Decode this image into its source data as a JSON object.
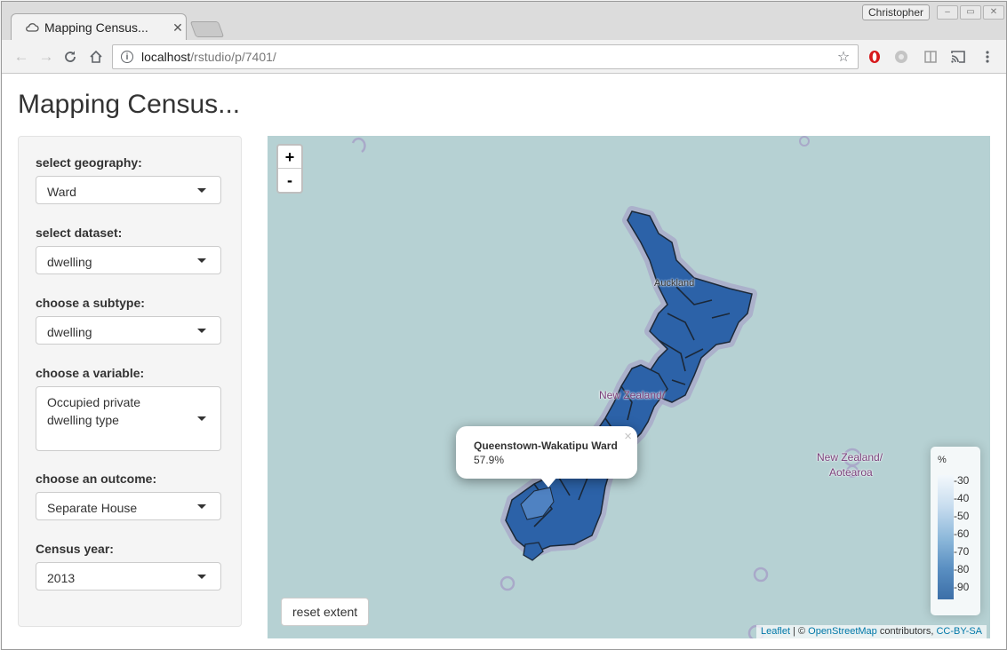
{
  "browser": {
    "tab_title": "Mapping Census...",
    "profile_name": "Christopher",
    "url_host": "localhost",
    "url_path": "/rstudio/p/7401/"
  },
  "app": {
    "title": "Mapping Census..."
  },
  "controls": [
    {
      "label": "select geography:",
      "value": "Ward"
    },
    {
      "label": "select dataset:",
      "value": "dwelling"
    },
    {
      "label": "choose a subtype:",
      "value": "dwelling"
    },
    {
      "label": "choose a variable:",
      "value": "Occupied private dwelling type"
    },
    {
      "label": "choose an outcome:",
      "value": "Separate House"
    },
    {
      "label": "Census year:",
      "value": "2013"
    }
  ],
  "map": {
    "zoom_in": "+",
    "zoom_out": "-",
    "place_labels": {
      "auckland": "Auckland",
      "nz_partial": "New Zealand/",
      "nz_line1": "New Zealand/",
      "nz_line2": "Aotearoa"
    },
    "popup": {
      "title": "Queenstown-Wakatipu Ward",
      "value": "57.9%",
      "close": "×"
    },
    "legend": {
      "title": "%",
      "ticks": [
        "30",
        "40",
        "50",
        "60",
        "70",
        "80",
        "90"
      ]
    },
    "reset_button": "reset extent",
    "attribution": {
      "leaflet": "Leaflet",
      "sep": " | © ",
      "osm": "OpenStreetMap",
      "contrib": " contributors, ",
      "license": "CC-BY-SA"
    }
  },
  "colors": {
    "choropleth_dark": "#2c62a8",
    "choropleth_light": "#e6f0f8",
    "sea": "#b6d1d3"
  }
}
